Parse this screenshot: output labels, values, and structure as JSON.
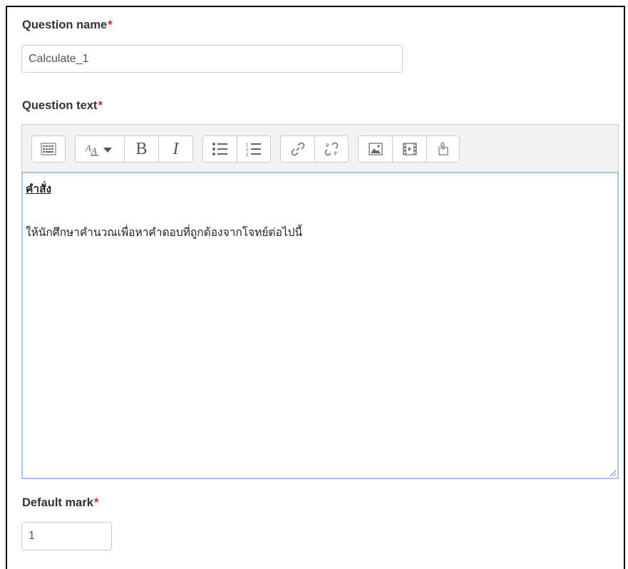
{
  "question_name": {
    "label": "Question name",
    "required_mark": "*",
    "value": "Calculate_1"
  },
  "question_text": {
    "label": "Question text",
    "required_mark": "*",
    "toolbar": {
      "buttons": [
        "toolbar-toggle-icon",
        "font-size-icon",
        "bold-icon",
        "italic-icon",
        "unordered-list-icon",
        "ordered-list-icon",
        "link-icon",
        "unlink-icon",
        "image-icon",
        "media-icon",
        "manage-files-icon"
      ],
      "bold_glyph": "B",
      "italic_glyph": "I"
    },
    "content": {
      "heading": "คำสั่ง",
      "body": "ให้นักศึกษาคำนวณเพื่อหาคำตอบที่ถูกต้องจากโจทย์ต่อไปนี้"
    }
  },
  "default_mark": {
    "label": "Default mark",
    "required_mark": "*",
    "value": "1"
  }
}
